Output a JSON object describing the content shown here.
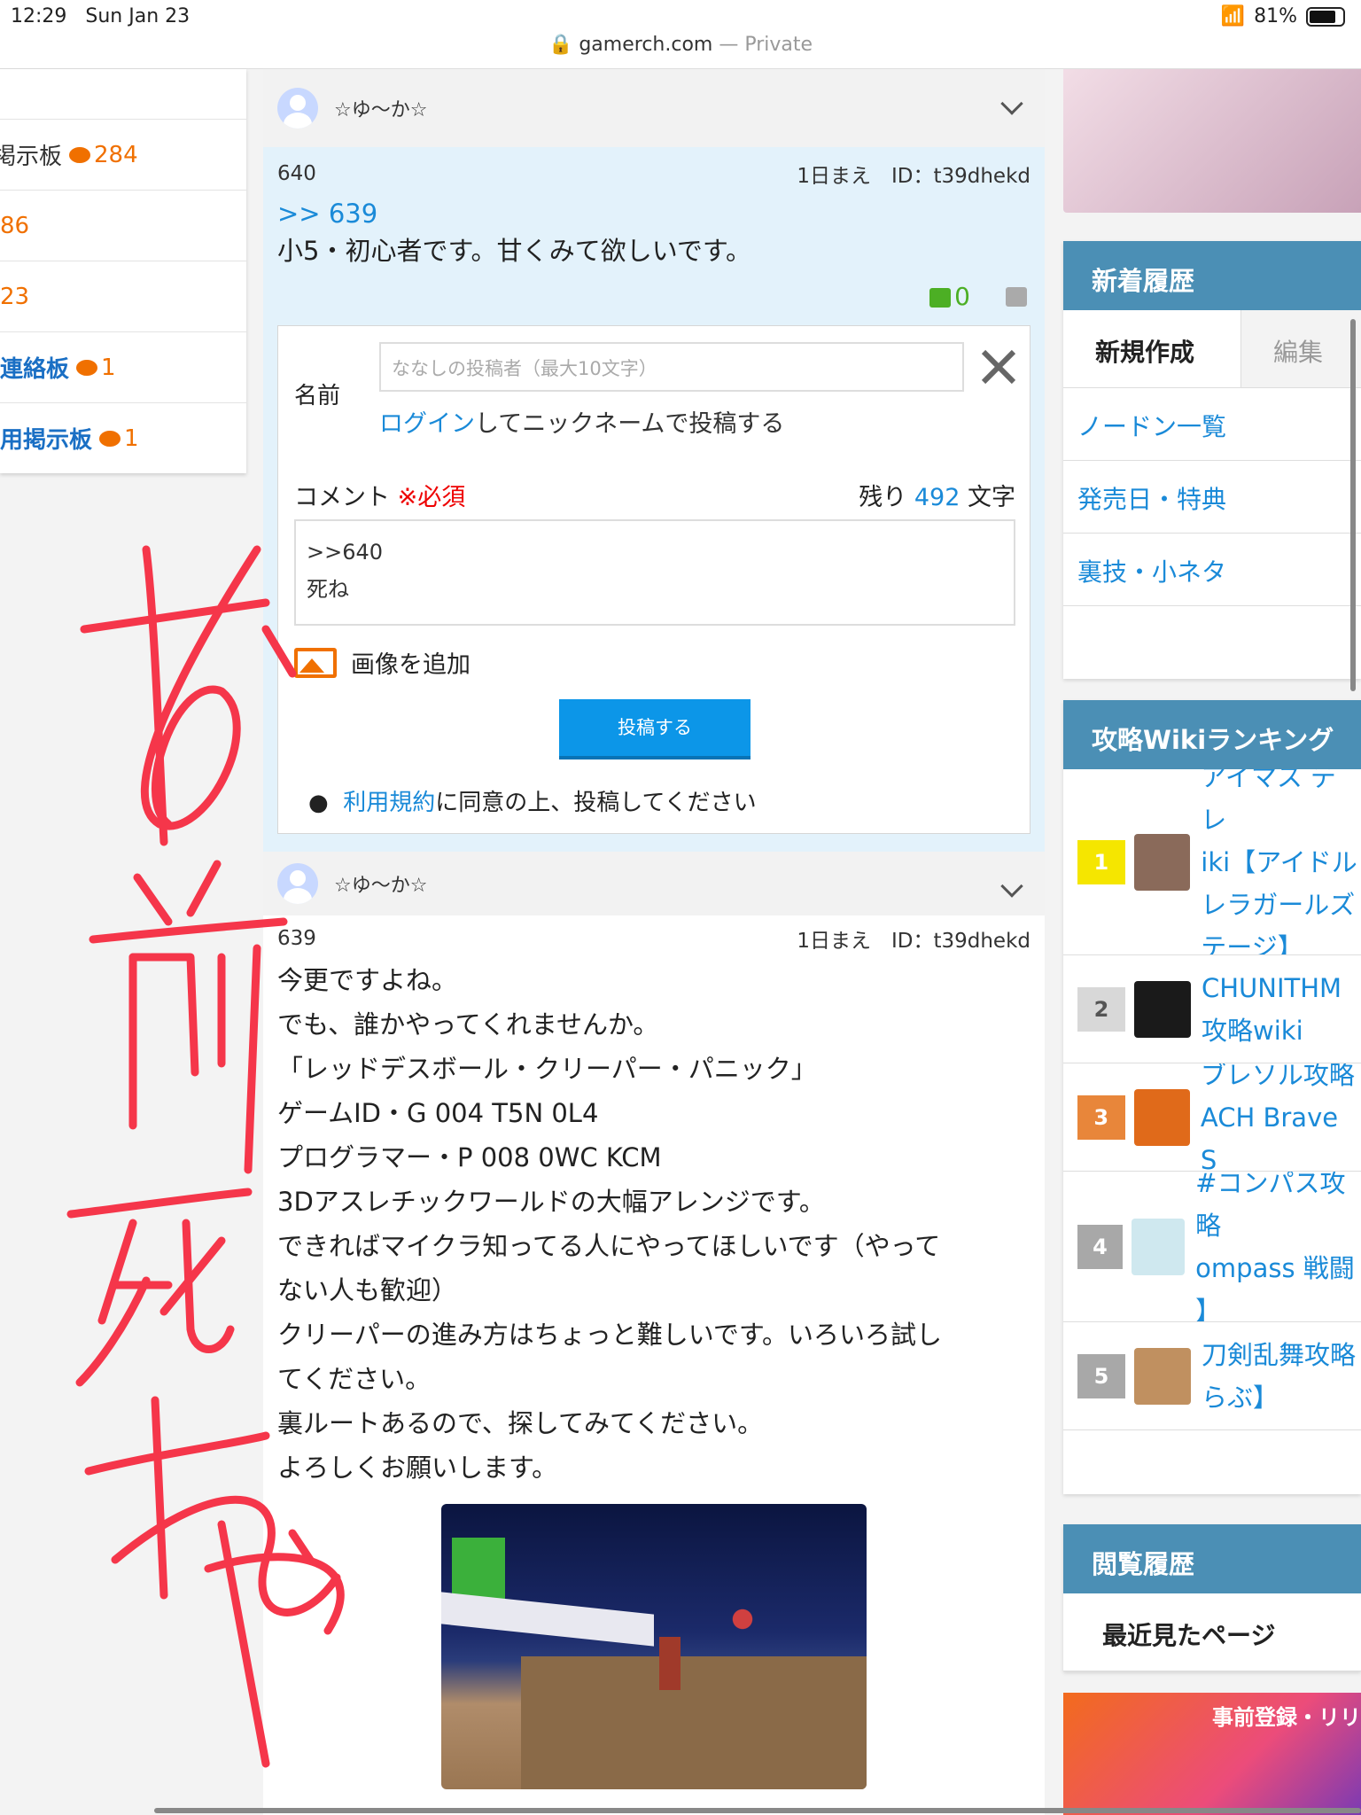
{
  "status": {
    "time": "12:29",
    "date": "Sun Jan 23",
    "battery": "81%"
  },
  "browser": {
    "host": "gamerch.com",
    "mode": "— Private"
  },
  "left": {
    "rows": [
      {
        "label": "",
        "count": ""
      },
      {
        "label": "掲示板",
        "count": "284"
      },
      {
        "label": "86",
        "count": ""
      },
      {
        "label": "23",
        "count": ""
      },
      {
        "label": "連絡板",
        "count": "1"
      },
      {
        "label": "用掲示板",
        "count": "1"
      }
    ]
  },
  "post640": {
    "user": "☆ゆ〜か☆",
    "number": "640",
    "meta": "1日まえ　ID：t39dhekd",
    "reply": ">> 639",
    "body": "小5・初心者です。甘くみて欲しいです。",
    "likes": "0"
  },
  "form": {
    "name_label": "名前",
    "name_placeholder": "ななしの投稿者（最大10文字）",
    "login_link": "ログイン",
    "login_rest": "してニックネームで投稿する",
    "comment_label": "コメント",
    "required": "※必須",
    "remain_pre": "残り",
    "remain_num": "492",
    "remain_post": "文字",
    "comment_text": ">>640\n死ね",
    "add_image": "画像を追加",
    "submit": "投稿する",
    "terms_link": "利用規約",
    "terms_rest": "に同意の上、投稿してください"
  },
  "post639": {
    "user": "☆ゆ〜か☆",
    "number": "639",
    "meta": "1日まえ　ID：t39dhekd",
    "lines": [
      "今更ですよね。",
      "でも、誰かやってくれませんか。",
      "「レッドデスボール・クリーパー・パニック」",
      "ゲームID・G 004 T5N 0L4",
      "プログラマー・P 008 0WC KCM",
      "3Dアスレチックワールドの大幅アレンジです。",
      "できればマイクラ知ってる人にやってほしいです（やって",
      "ない人も歓迎）",
      "クリーパーの進み方はちょっと難しいです。いろいろ試し",
      "てください。",
      "裏ルートあるので、探してみてください。",
      "よろしくお願いします。"
    ]
  },
  "right": {
    "history_title": "新着履歴",
    "tab_new": "新規作成",
    "tab_edit": "編集",
    "links": [
      "ノードン一覧",
      "発売日・特典",
      "裏技・小ネタ"
    ],
    "ranking_title": "攻略Wikiランキング",
    "ranks": [
      {
        "n": "1",
        "color": "#f5e600",
        "thumb": "#8a6a5a",
        "title": "アイマス デレ\niki【アイドル\nレラガールズ\nテージ】"
      },
      {
        "n": "2",
        "color": "#d8d8d8",
        "thumb": "#1a1a1a",
        "title": "CHUNITHM\n攻略wiki"
      },
      {
        "n": "3",
        "color": "#e8863a",
        "thumb": "#e06a1a",
        "title": "ブレソル攻略\nACH Brave S"
      },
      {
        "n": "4",
        "color": "#a8a8a8",
        "thumb": "#cfe8ef",
        "title": "#コンパス攻略\nompass 戦闘\n】"
      },
      {
        "n": "5",
        "color": "#a8a8a8",
        "thumb": "#c09060",
        "title": "刀剣乱舞攻略\nらぶ】"
      }
    ],
    "viewed_title": "閲覧履歴",
    "recent": "最近見たページ",
    "ad_text": "事前登録・リリ"
  },
  "overlay": {
    "handwriting": "お前死ねや",
    "color": "#f5364a"
  }
}
